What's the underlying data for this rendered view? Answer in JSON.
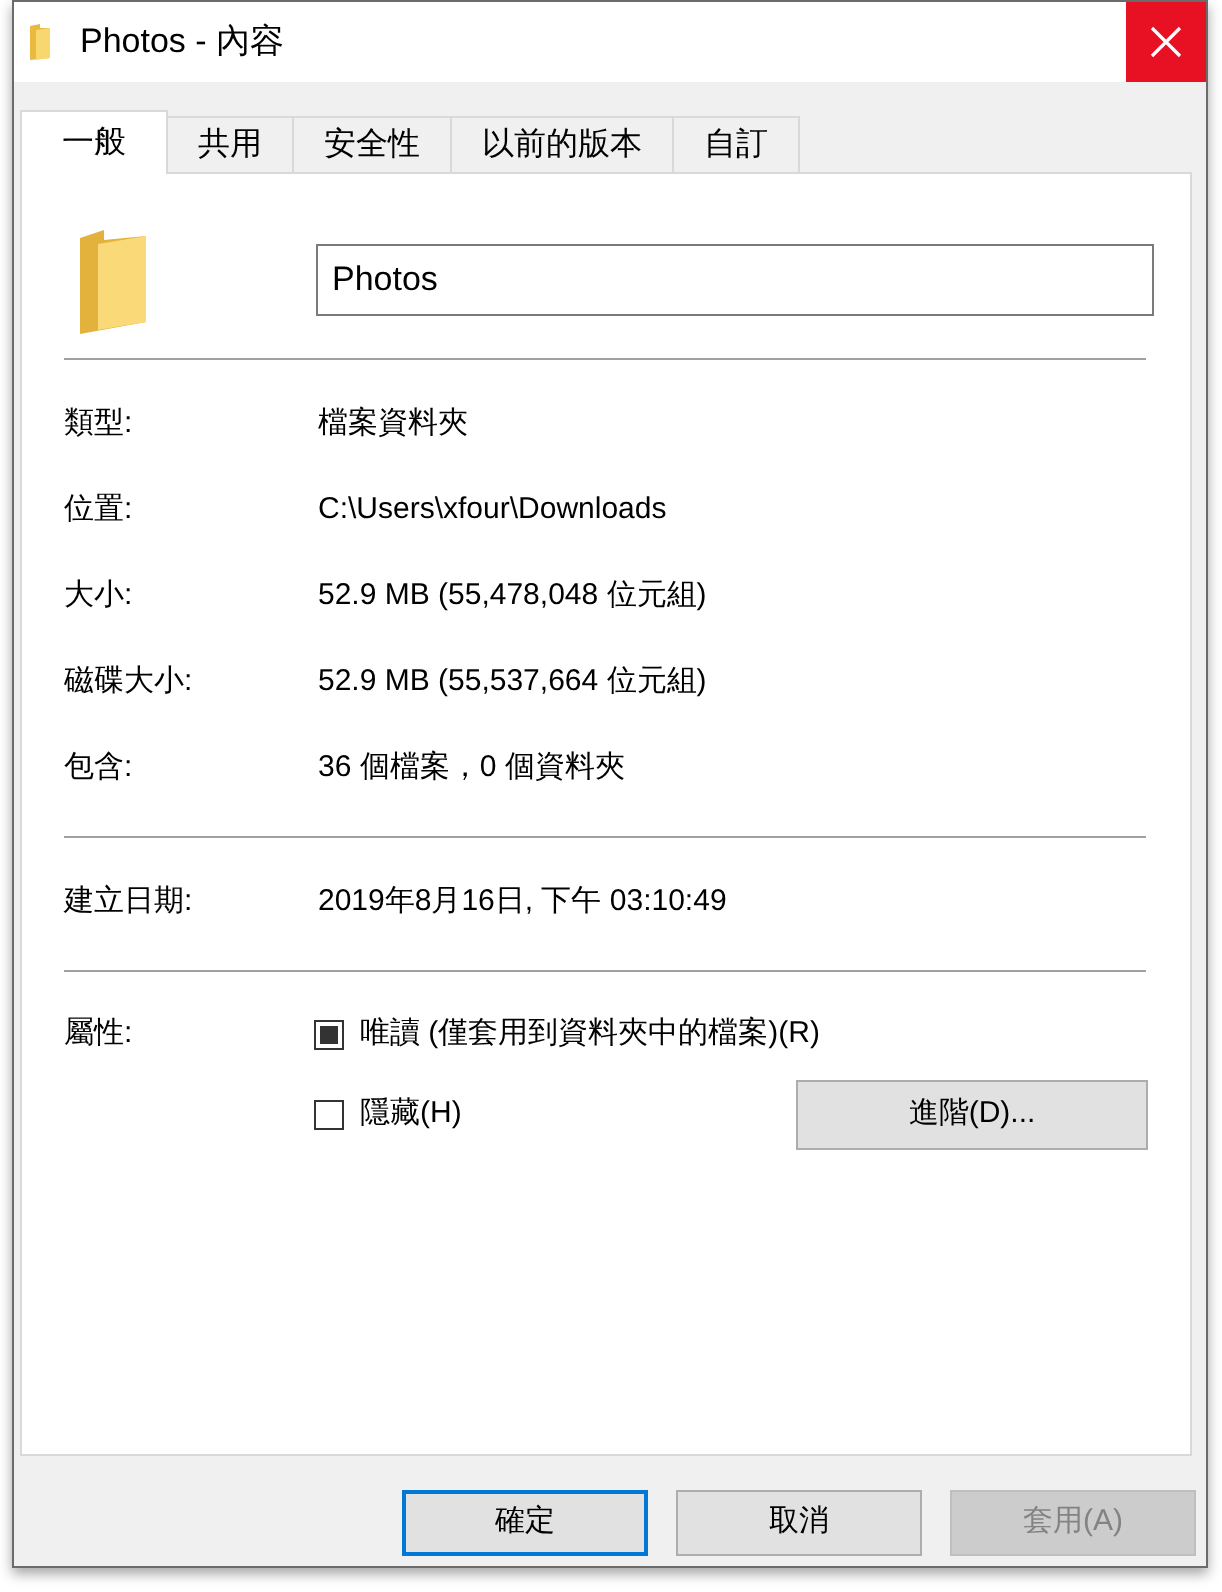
{
  "window": {
    "title": "Photos - 內容"
  },
  "tabs": [
    {
      "label": "一般",
      "selected": true
    },
    {
      "label": "共用",
      "selected": false
    },
    {
      "label": "安全性",
      "selected": false
    },
    {
      "label": "以前的版本",
      "selected": false
    },
    {
      "label": "自訂",
      "selected": false
    }
  ],
  "name_field": {
    "value": "Photos"
  },
  "property_groups": [
    {
      "rows": [
        {
          "label": "類型:",
          "value": "檔案資料夾"
        },
        {
          "label": "位置:",
          "value": "C:\\Users\\xfour\\Downloads"
        },
        {
          "label": "大小:",
          "value": "52.9 MB (55,478,048 位元組)"
        },
        {
          "label": "磁碟大小:",
          "value": "52.9 MB (55,537,664 位元組)"
        },
        {
          "label": "包含:",
          "value": "36 個檔案，0 個資料夾"
        }
      ]
    },
    {
      "rows": [
        {
          "label": "建立日期:",
          "value": "2019年8月16日, 下午 03:10:49"
        }
      ]
    }
  ],
  "attributes": {
    "label": "屬性:",
    "options": [
      {
        "label": "唯讀 (僅套用到資料夾中的檔案)(R)",
        "checked": false,
        "indeterminate": true
      },
      {
        "label": "隱藏(H)",
        "checked": false,
        "indeterminate": false
      }
    ],
    "advanced_button": "進階(D)..."
  },
  "buttons": [
    {
      "label": "確定",
      "default": true,
      "disabled": false
    },
    {
      "label": "取消",
      "default": false,
      "disabled": false
    },
    {
      "label": "套用(A)",
      "default": false,
      "disabled": true
    }
  ]
}
